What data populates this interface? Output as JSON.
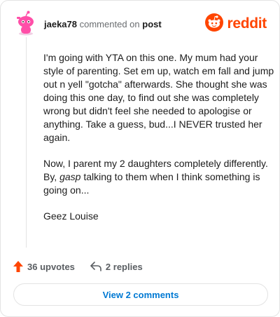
{
  "header": {
    "username": "jaeka78",
    "action_text": "commented on",
    "post_link": "post",
    "logo_text": "reddit"
  },
  "comment": {
    "paragraph1": "I'm going with YTA on this one. My mum had your style of parenting. Set em up, watch em fall and jump out n yell \"gotcha\" afterwards. She thought she was doing this one day, to find out she was completely wrong but didn't feel she needed to apologise or anything. Take a guess, bud...I NEVER trusted her again.",
    "paragraph2_before": "Now, I parent my 2 daughters completely differently. By, ",
    "paragraph2_em": "gasp",
    "paragraph2_after": " talking to them when I think something is going on...",
    "paragraph3": "Geez Louise"
  },
  "actions": {
    "upvotes_label": "36 upvotes",
    "replies_label": "2 replies"
  },
  "view_comments_label": "View 2 comments",
  "colors": {
    "brand": "#ff4500",
    "link": "#0079d3",
    "avatar_pink": "#ff4fa8"
  },
  "icons": {
    "avatar": "snoo-avatar-icon",
    "logo": "reddit-logo-icon",
    "upvote": "upvote-arrow-icon",
    "reply": "reply-arrow-icon"
  }
}
